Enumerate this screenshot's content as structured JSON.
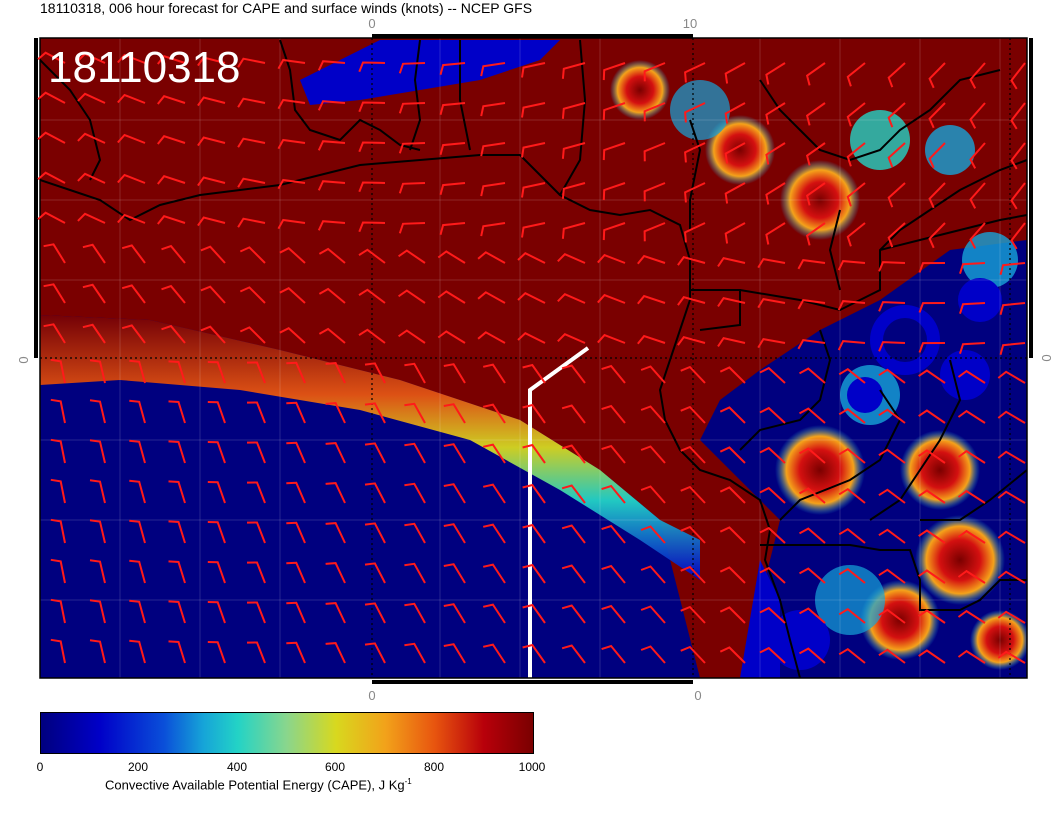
{
  "title": "18110318, 006 hour forecast for CAPE and surface winds (knots) -- NCEP GFS",
  "valid_time_label": "18110318",
  "axis_labels": {
    "top": [
      "0",
      "10"
    ],
    "bottom": [
      "0",
      "0"
    ],
    "left": "0",
    "right": "0"
  },
  "colorbar": {
    "ticks": [
      "0",
      "200",
      "400",
      "600",
      "800",
      "1000"
    ],
    "range": [
      0,
      1000
    ],
    "label_main": "Convective Available Potential Energy (CAPE), J Kg",
    "label_sup": "-1",
    "colors": [
      "#00007f",
      "#0000c8",
      "#16a4d8",
      "#23d3c6",
      "#d8d81e",
      "#f2a21a",
      "#e8550f",
      "#7a0000"
    ]
  },
  "colors": {
    "wind_barb": "#ff1a1a",
    "coastline": "#000000",
    "track": "#ffffff"
  }
}
